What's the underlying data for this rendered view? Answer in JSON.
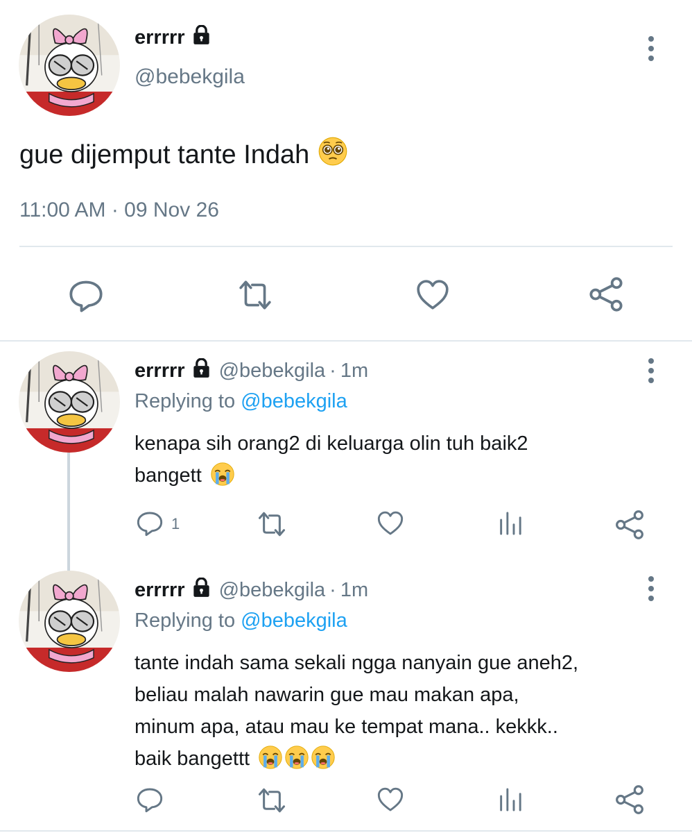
{
  "main_tweet": {
    "display_name": "errrrr",
    "handle": "@bebekgila",
    "text": "gue dijemput tante Indah",
    "text_emoji": "pleading-face",
    "timestamp": "11:00 AM · 09 Nov 26",
    "actions": [
      "reply-icon",
      "retweet-icon",
      "like-icon",
      "share-icon"
    ]
  },
  "replies": [
    {
      "display_name": "errrrr",
      "handle": "@bebekgila",
      "separator": "·",
      "time": "1m",
      "replying_prefix": "Replying to",
      "replying_to": "@bebekgila",
      "lines": [
        "kenapa sih orang2 di keluarga olin tuh baik2",
        "bangett"
      ],
      "trailing_emoji": [
        "loudly-crying-face"
      ],
      "reply_count": "1",
      "actions": [
        "reply-icon",
        "retweet-icon",
        "like-icon",
        "analytics-icon",
        "share-icon"
      ]
    },
    {
      "display_name": "errrrr",
      "handle": "@bebekgila",
      "separator": "·",
      "time": "1m",
      "replying_prefix": "Replying to",
      "replying_to": "@bebekgila",
      "lines": [
        "tante indah sama sekali ngga nanyain gue aneh2,",
        "beliau malah nawarin gue mau makan apa,",
        "minum apa, atau mau ke tempat mana.. kekkk..",
        "baik bangettt"
      ],
      "trailing_emoji": [
        "loudly-crying-face",
        "loudly-crying-face",
        "loudly-crying-face"
      ],
      "reply_count": "",
      "actions": [
        "reply-icon",
        "retweet-icon",
        "like-icon",
        "analytics-icon",
        "share-icon"
      ]
    }
  ],
  "colors": {
    "text": "#14171a",
    "secondary": "#657786",
    "link": "#1da1f2",
    "divider": "#e1e8ed",
    "thread_line": "#ccd6dd"
  }
}
